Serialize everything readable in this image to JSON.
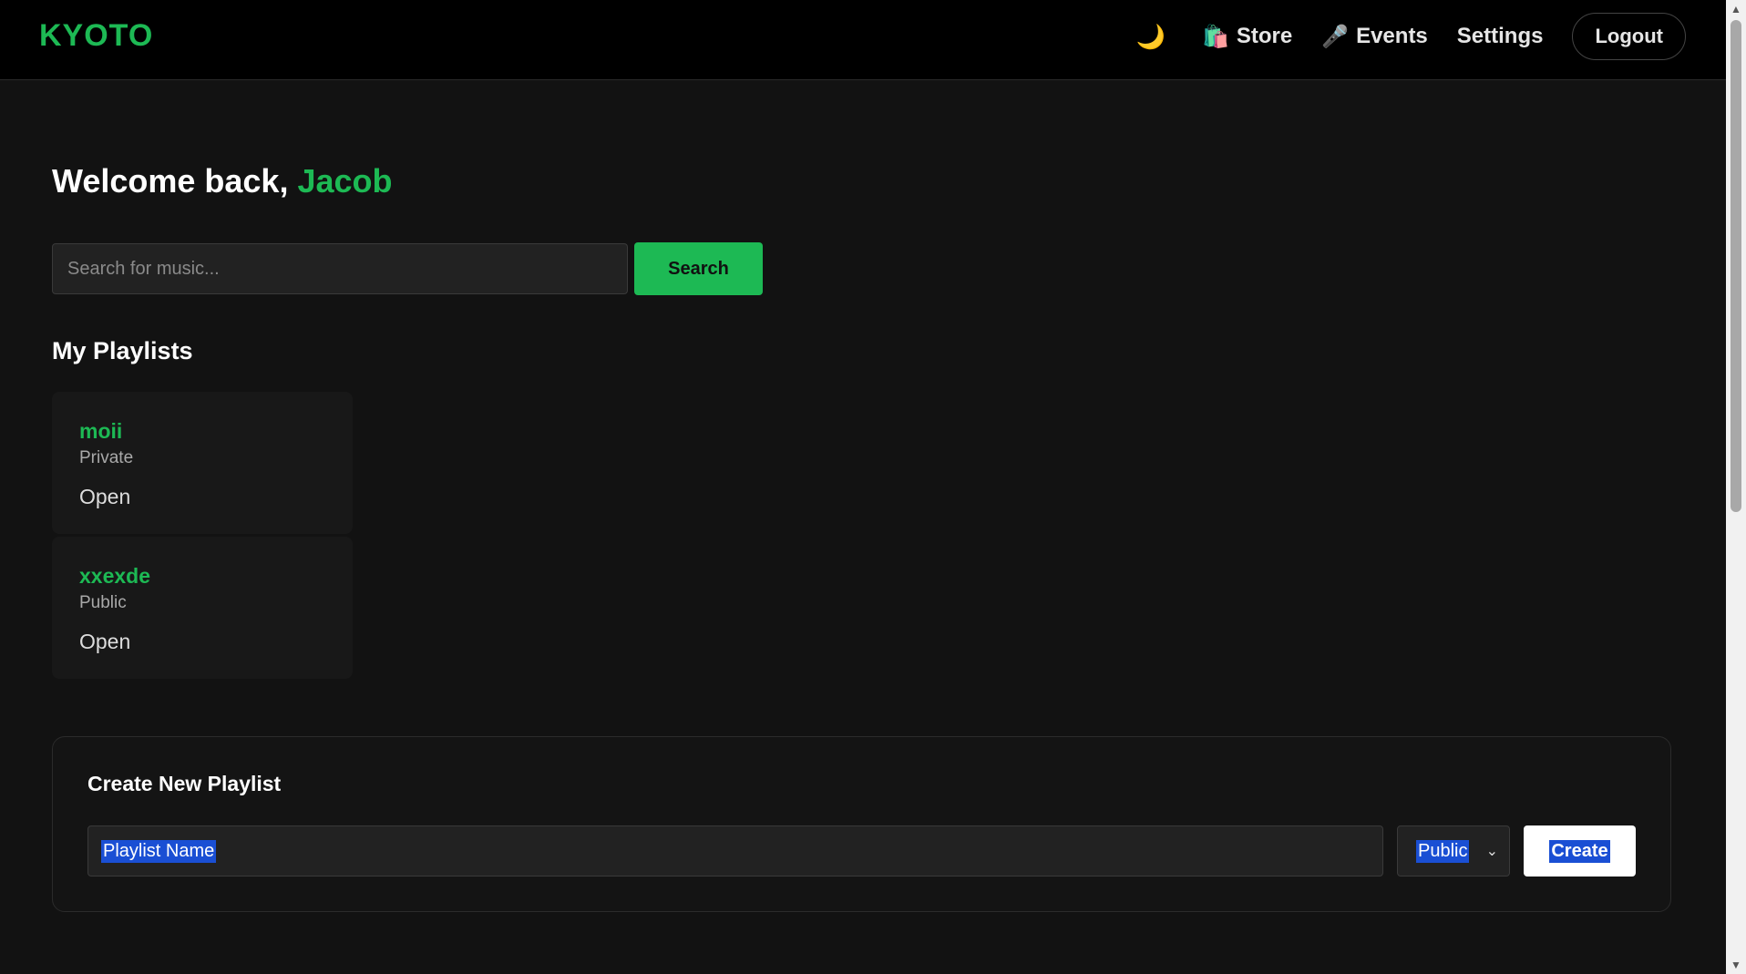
{
  "brand": {
    "logo": "KYOTO",
    "accent_color": "#1db954"
  },
  "nav": {
    "theme_icon": "🌙",
    "store_icon": "🛍️",
    "store_label": "Store",
    "events_icon": "🎤",
    "events_label": "Events",
    "settings_label": "Settings",
    "logout_label": "Logout"
  },
  "welcome": {
    "prefix": "Welcome back, ",
    "username": "Jacob"
  },
  "search": {
    "placeholder": "Search for music...",
    "button_label": "Search"
  },
  "playlists": {
    "title": "My Playlists",
    "items": [
      {
        "name": "moii",
        "visibility": "Private",
        "action": "Open"
      },
      {
        "name": "xxexde",
        "visibility": "Public",
        "action": "Open"
      }
    ]
  },
  "create_playlist": {
    "title": "Create New Playlist",
    "name_placeholder": "Playlist Name",
    "visibility_selected": "Public",
    "button_label": "Create"
  }
}
